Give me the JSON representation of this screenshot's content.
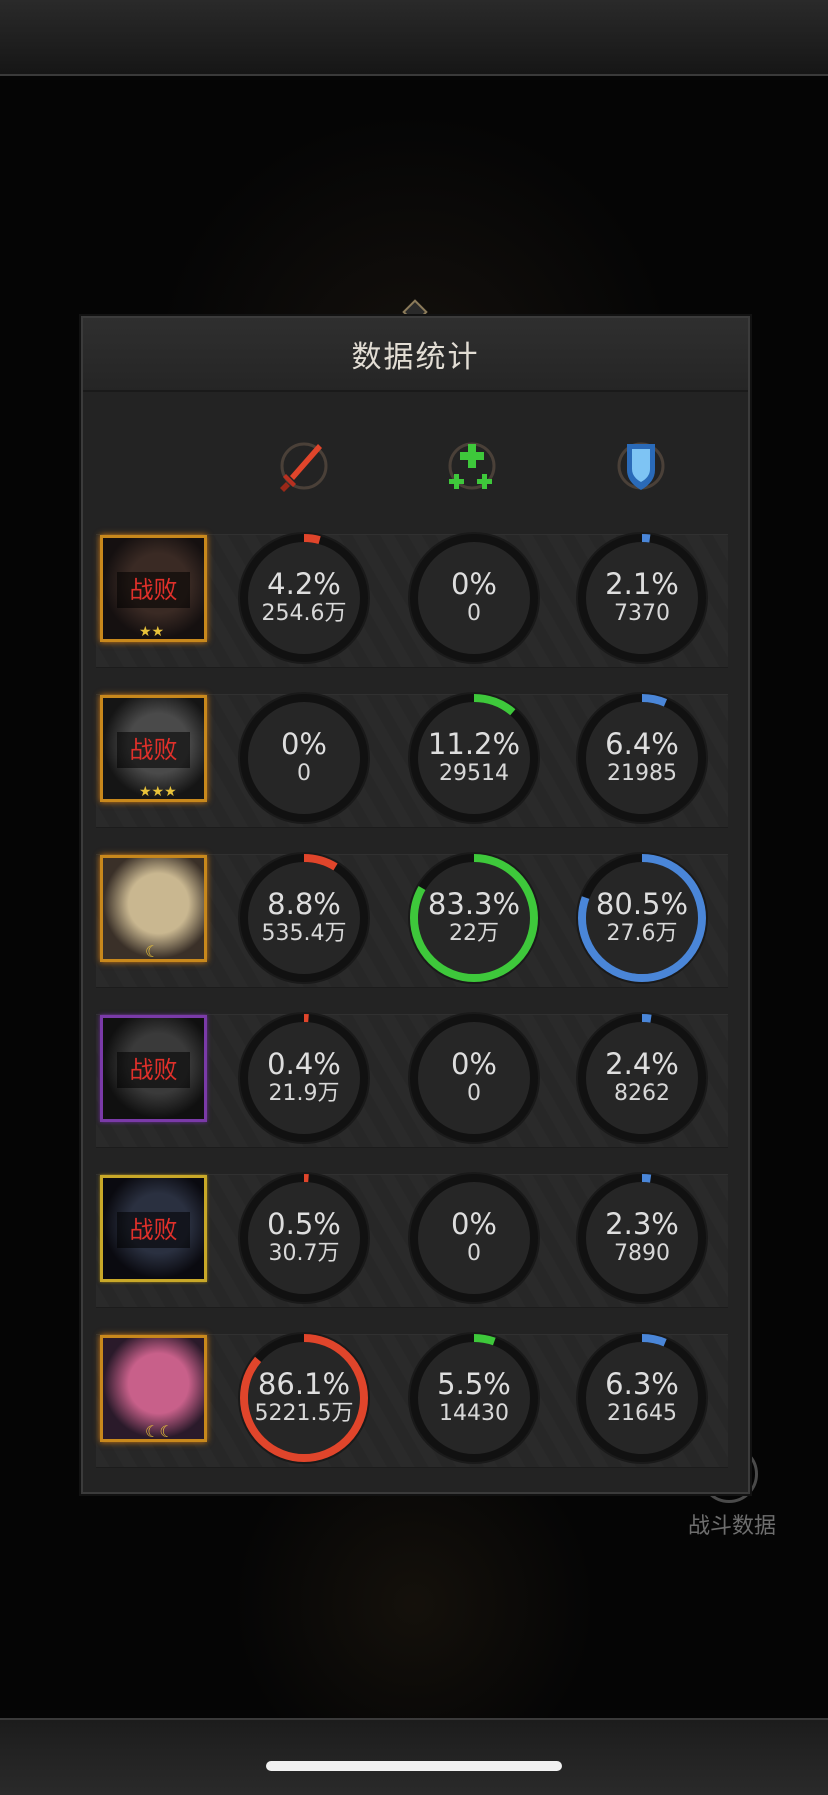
{
  "panel": {
    "title": "数据统计"
  },
  "background": {
    "right_label": "战斗数据"
  },
  "columns": [
    {
      "name": "damage",
      "icon": "sword-icon",
      "color": "#e0452b"
    },
    {
      "name": "healing",
      "icon": "heal-cross-icon",
      "color": "#3ec83b"
    },
    {
      "name": "shield",
      "icon": "shield-icon",
      "color": "#4a86d8"
    }
  ],
  "rows": [
    {
      "defeated": true,
      "defeat_label": "战败",
      "badge": "★★",
      "frame": "orange",
      "stats": [
        {
          "pct_label": "4.2%",
          "pct": 4.2,
          "value": "254.6万"
        },
        {
          "pct_label": "0%",
          "pct": 0,
          "value": "0"
        },
        {
          "pct_label": "2.1%",
          "pct": 2.1,
          "value": "7370"
        }
      ]
    },
    {
      "defeated": true,
      "defeat_label": "战败",
      "badge": "★★★",
      "frame": "orange",
      "stats": [
        {
          "pct_label": "0%",
          "pct": 0,
          "value": "0"
        },
        {
          "pct_label": "11.2%",
          "pct": 11.2,
          "value": "29514"
        },
        {
          "pct_label": "6.4%",
          "pct": 6.4,
          "value": "21985"
        }
      ]
    },
    {
      "defeated": false,
      "defeat_label": "",
      "badge": "☾",
      "frame": "orange",
      "stats": [
        {
          "pct_label": "8.8%",
          "pct": 8.8,
          "value": "535.4万"
        },
        {
          "pct_label": "83.3%",
          "pct": 83.3,
          "value": "22万"
        },
        {
          "pct_label": "80.5%",
          "pct": 80.5,
          "value": "27.6万"
        }
      ]
    },
    {
      "defeated": true,
      "defeat_label": "战败",
      "badge": "",
      "frame": "purple",
      "stats": [
        {
          "pct_label": "0.4%",
          "pct": 0.4,
          "value": "21.9万"
        },
        {
          "pct_label": "0%",
          "pct": 0,
          "value": "0"
        },
        {
          "pct_label": "2.4%",
          "pct": 2.4,
          "value": "8262"
        }
      ]
    },
    {
      "defeated": true,
      "defeat_label": "战败",
      "badge": "",
      "frame": "yellow",
      "stats": [
        {
          "pct_label": "0.5%",
          "pct": 0.5,
          "value": "30.7万"
        },
        {
          "pct_label": "0%",
          "pct": 0,
          "value": "0"
        },
        {
          "pct_label": "2.3%",
          "pct": 2.3,
          "value": "7890"
        }
      ]
    },
    {
      "defeated": false,
      "defeat_label": "",
      "badge": "☾☾",
      "frame": "orange",
      "stats": [
        {
          "pct_label": "86.1%",
          "pct": 86.1,
          "value": "5221.5万"
        },
        {
          "pct_label": "5.5%",
          "pct": 5.5,
          "value": "14430"
        },
        {
          "pct_label": "6.3%",
          "pct": 6.3,
          "value": "21645"
        }
      ]
    }
  ]
}
